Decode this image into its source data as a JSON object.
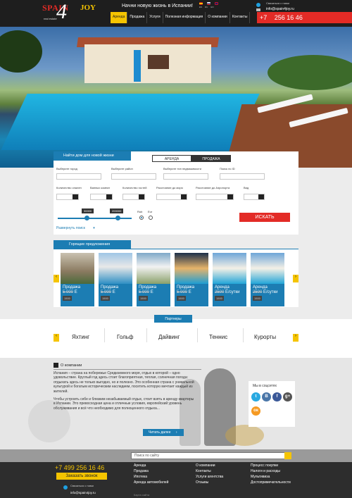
{
  "header": {
    "logo": {
      "spain": "SPAIN",
      "four": "4",
      "joy": "JOY",
      "sub": "real estate"
    },
    "tagline": "Начни новую жизнь в Испании!",
    "languages": [
      "ES",
      "RU",
      "EN"
    ],
    "contact_label": "Связаться с нами",
    "email": "info@spain4joy.ru",
    "phone_prefix": "+7",
    "phone_number": "256 16 46",
    "nav": [
      "Аренда",
      "Продажа",
      "Услуги",
      "Полезная информация",
      "О компании",
      "Контакты"
    ]
  },
  "search": {
    "title": "Найти дом для новой жизни",
    "tab_rent": "АРЕНДА",
    "tab_sale": "ПРОДАЖА",
    "labels": {
      "city": "Выберите город",
      "district": "Выберите район",
      "type": "Выберите тип недвижимости",
      "id": "Поиск по ID",
      "bedrooms": "Количество спален",
      "bathrooms": "Ванных комнат",
      "guests": "Количество гостей",
      "sea": "Расстояние до моря",
      "airport": "Расстояние до Аэропорта",
      "view": "Вид"
    },
    "price_min": "30000",
    "price_max": "200000",
    "currency_rub": "Rub",
    "currency_eur": "Eur",
    "button": "ИСКАТЬ",
    "expand": "Развернуть поиск"
  },
  "hot": {
    "title": "Горящие предложения",
    "cards": [
      {
        "type": "Продажа",
        "old": "5 000",
        "unit": "Е",
        "new": "1500"
      },
      {
        "type": "Продажа",
        "old": "5 000",
        "unit": "Е",
        "new": "1500"
      },
      {
        "type": "Продажа",
        "old": "5 000",
        "unit": "Е",
        "new": "1500"
      },
      {
        "type": "Продажа",
        "old": "5 000",
        "unit": "Е",
        "new": "1500"
      },
      {
        "type": "Аренда",
        "old": "2500",
        "unit": "Е/сутки",
        "new": "1500"
      },
      {
        "type": "Аренда",
        "old": "2500",
        "unit": "Е/сутки",
        "new": "1500"
      }
    ]
  },
  "partners": {
    "title": "Партнеры",
    "items": [
      "Яхтинг",
      "Гольф",
      "Дайвинг",
      "Теннис",
      "Курорты"
    ]
  },
  "about": {
    "title": "О компании",
    "p1": "Испания – страна на побережье Средиземного моря, отдых в которой – одно удовольствие. Круглый год здесь стоит благоприятная, теплая, солнечная погода: отдыхать здесь не только выгодно, но и полезно. Это особенная страна с уникальной культурой и богатым историческим наследием, посетить которую мечтает каждый из жителей.",
    "p2": "Чтобы устроить себе и близким незабываемый отдых, стоит взять в аренду квартиры в Испании. Это превосходная цена и отличные условия, европейский уровень обслуживания и всё что необходимо для полноценного отдыха...",
    "more": "Читать далее"
  },
  "social": {
    "title": "Мы в соцсетях",
    "icons": [
      {
        "name": "twitter-icon",
        "glyph": "t",
        "color": "#29a9e1"
      },
      {
        "name": "vk-icon",
        "glyph": "В",
        "color": "#4a76a8"
      },
      {
        "name": "facebook-icon",
        "glyph": "f",
        "color": "#3b5998"
      },
      {
        "name": "google-plus-icon",
        "glyph": "g+",
        "color": "#555555"
      },
      {
        "name": "odnoklassniki-icon",
        "glyph": "ок",
        "color": "#f59a23"
      }
    ]
  },
  "site_search": {
    "placeholder": "Поиск по сайту"
  },
  "footer": {
    "phone": "+7 499 256 16 46",
    "call": "Заказать звонок",
    "contact_label": "Связаться с нами",
    "email": "info@spain4joy.ru",
    "col1": [
      "Аренда",
      "Продажа",
      "Ипотека",
      "Аренда автомобилей"
    ],
    "col2": [
      "О компании",
      "Контакты",
      "Услуги агентства",
      "Отзывы"
    ],
    "col3": [
      "Процесс покупки",
      "Налоги и расходы",
      "Мультивиза",
      "Достопримечательности"
    ],
    "map": "Карта сайта"
  },
  "colors": {
    "accent_blue": "#1c7db3",
    "accent_red": "#e32b26",
    "accent_yellow": "#f5c400",
    "header_bg": "#1e1e1e"
  }
}
